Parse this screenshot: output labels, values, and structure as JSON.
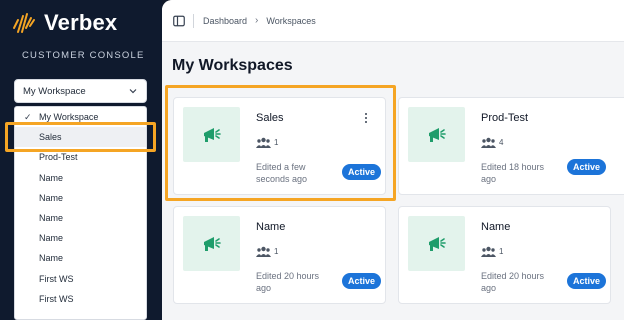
{
  "app": {
    "name": "Verbex",
    "subtitle": "CUSTOMER CONSOLE"
  },
  "workspace_select": {
    "value": "My Workspace"
  },
  "dropdown": {
    "items": [
      {
        "label": "My Workspace",
        "checked": true
      },
      {
        "label": "Sales",
        "hovered": true
      },
      {
        "label": "Prod-Test"
      },
      {
        "label": "Name"
      },
      {
        "label": "Name"
      },
      {
        "label": "Name"
      },
      {
        "label": "Name"
      },
      {
        "label": "Name"
      },
      {
        "label": "First WS"
      },
      {
        "label": "First WS"
      }
    ]
  },
  "breadcrumb": {
    "items": [
      "Dashboard",
      "Workspaces"
    ]
  },
  "page_title": "My Workspaces",
  "cards": [
    {
      "title": "Sales",
      "members": "1",
      "edited": "Edited a few seconds ago",
      "status": "Active"
    },
    {
      "title": "Prod-Test",
      "members": "4",
      "edited": "Edited 18 hours ago",
      "status": "Active"
    },
    {
      "title": "Name",
      "members": "1",
      "edited": "Edited 20 hours ago",
      "status": "Active"
    },
    {
      "title": "Name",
      "members": "1",
      "edited": "Edited 20 hours ago",
      "status": "Active"
    }
  ],
  "colors": {
    "accent": "#1c74d9",
    "highlight": "#f5a524",
    "sidebar": "#0f1a2e",
    "thumb_bg": "#e3f3ec",
    "icon_green": "#1f9d6b"
  },
  "icons": {
    "logo": "waveform-icon",
    "toggle": "sidebar-toggle-icon",
    "thumb": "megaphone-icon",
    "members": "users-icon"
  }
}
